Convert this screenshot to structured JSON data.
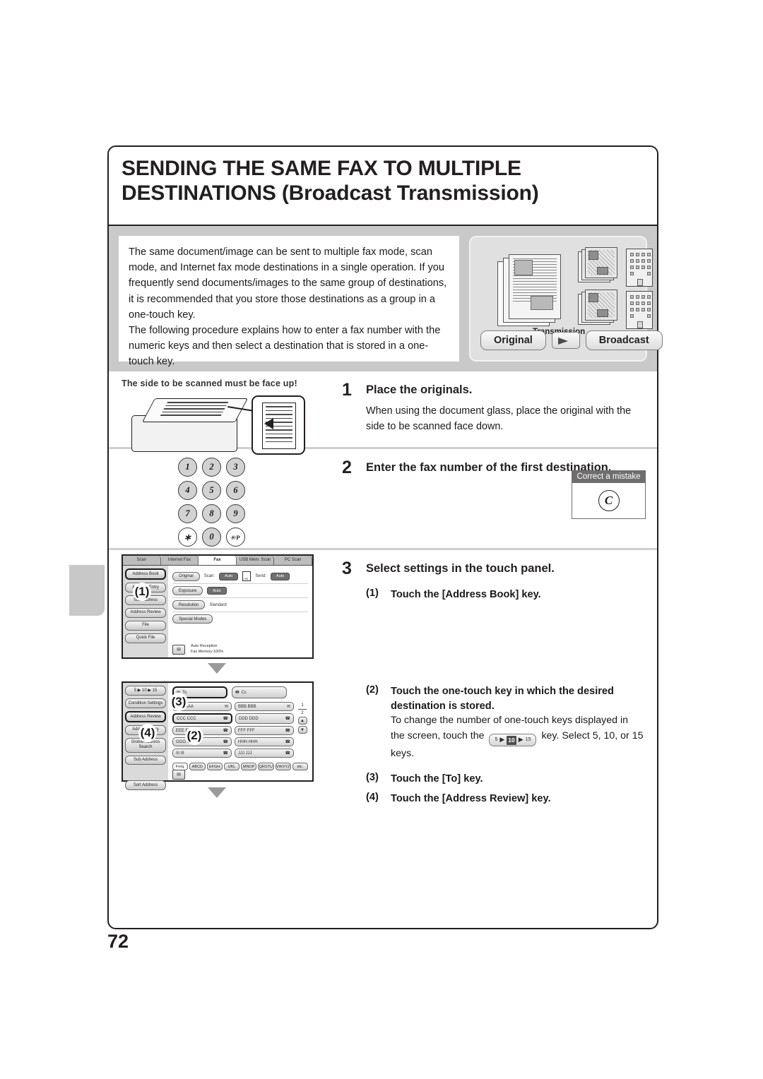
{
  "page": {
    "number": "72"
  },
  "title": {
    "line1": "SENDING THE SAME FAX TO MULTIPLE",
    "line2": "DESTINATIONS (Broadcast Transmission)"
  },
  "intro": {
    "paragraph1": "The same document/image can be sent to multiple fax mode, scan mode, and Internet fax mode destinations in a single operation. If you frequently send documents/images to the same group of destinations, it is recommended that you store those destinations as a group in a one-touch key.",
    "paragraph2": "The following procedure explains how to enter a fax number with the numeric keys and then select a destination that is stored in a one-touch key."
  },
  "figure": {
    "transmission_label": "Transmission",
    "original_label": "Original",
    "broadcast_label": "Broadcast"
  },
  "steps": [
    {
      "number": "1",
      "title": "Place the originals.",
      "body": "When using the document glass, place the original with the side to be scanned face down.",
      "caption": "The side to be scanned must be face up!"
    },
    {
      "number": "2",
      "title": "Enter the fax number of the first destination.",
      "badge": {
        "caption": "Correct a mistake",
        "key": "C"
      },
      "keypad": [
        [
          "1",
          "2",
          "3"
        ],
        [
          "4",
          "5",
          "6"
        ],
        [
          "7",
          "8",
          "9"
        ],
        [
          "∗",
          "0",
          "#/P"
        ]
      ]
    },
    {
      "number": "3",
      "title": "Select settings in the touch panel.",
      "substeps": [
        {
          "index": "(1)",
          "text": "Touch the [Address Book] key."
        },
        {
          "index": "(2)",
          "text": "Touch the one-touch key in which the desired destination is stored.",
          "note_a": "To change the number of one-touch keys displayed in the screen, touch the",
          "note_b": "key. Select 5, 10, or 15 keys.",
          "chip": {
            "left": "5",
            "mid": "10",
            "right": "15"
          }
        },
        {
          "index": "(3)",
          "text": "Touch the [To] key."
        },
        {
          "index": "(4)",
          "text": "Touch the [Address Review] key."
        }
      ]
    }
  ],
  "lcd_fax": {
    "tabs": [
      {
        "label": "Scan",
        "active": false
      },
      {
        "label": "Internet Fax",
        "active": false
      },
      {
        "label": "Fax",
        "active": true
      },
      {
        "label": "USB Mem. Scan",
        "active": false
      },
      {
        "label": "PC Scan",
        "active": false
      }
    ],
    "side_buttons": [
      {
        "label": "Address Book",
        "highlight": true
      },
      {
        "label": "Address Entry",
        "highlight": false
      },
      {
        "label": "Sub Address",
        "highlight": false
      },
      {
        "label": "Address Review",
        "highlight": false
      },
      {
        "label": "File",
        "highlight": false
      },
      {
        "label": "Quick File",
        "highlight": false
      }
    ],
    "rows": [
      {
        "button": "Original",
        "label1": "Scan:",
        "value1": "Auto",
        "size": "A4",
        "label2": "Send:",
        "value2": "Auto"
      },
      {
        "button": "Exposure",
        "value1": "Auto"
      },
      {
        "button": "Resolution",
        "value1": "Standard"
      },
      {
        "button": "Special Modes"
      }
    ],
    "status": {
      "line1": "Auto Reception",
      "line2": "Fax Memory:100%"
    },
    "callout": "(1)"
  },
  "lcd_address": {
    "keys_selector": {
      "left": "5",
      "mid": "10",
      "right": "15"
    },
    "side_buttons": [
      {
        "label": "Condition Settings",
        "highlight": false
      },
      {
        "label": "Address Review",
        "highlight": true
      },
      {
        "label": "Address Entry",
        "highlight": false
      },
      {
        "label": "Global Address Search",
        "highlight": false
      },
      {
        "label": "Sub Address",
        "highlight": false
      },
      {
        "label": "Sort Address",
        "highlight": false
      }
    ],
    "to_button": {
      "label": "To",
      "highlight": true
    },
    "cc_button": {
      "label": "Cc",
      "highlight": false
    },
    "address_rows": [
      [
        {
          "name": "AAA AAA",
          "type": "mail",
          "highlight": false
        },
        {
          "name": "BBB BBB",
          "type": "mail",
          "highlight": false
        }
      ],
      [
        {
          "name": "CCC CCC",
          "type": "fax",
          "highlight": true
        },
        {
          "name": "DDD DDD",
          "type": "fax",
          "highlight": false
        }
      ],
      [
        {
          "name": "EEE EEE",
          "type": "fax",
          "highlight": false
        },
        {
          "name": "FFF FFF",
          "type": "fax",
          "highlight": false
        }
      ],
      [
        {
          "name": "GGG GGG",
          "type": "fax",
          "highlight": false
        },
        {
          "name": "HHH HHH",
          "type": "fax",
          "highlight": false
        }
      ],
      [
        {
          "name": "III III",
          "type": "fax",
          "highlight": false
        },
        {
          "name": "JJJ JJJ",
          "type": "fax",
          "highlight": false
        }
      ]
    ],
    "pager": {
      "current": "1",
      "total": "2"
    },
    "alpha_tabs": [
      {
        "label": "Freq.",
        "active": true
      },
      {
        "label": "ABCD",
        "active": false
      },
      {
        "label": "EFGH",
        "active": false
      },
      {
        "label": "IJKL",
        "active": false
      },
      {
        "label": "MNOP",
        "active": false
      },
      {
        "label": "QRSTU",
        "active": false
      },
      {
        "label": "VWXYZ",
        "active": false
      },
      {
        "label": "etc.",
        "active": false
      }
    ],
    "callouts": {
      "two": "(2)",
      "three": "(3)",
      "four": "(4)"
    }
  }
}
